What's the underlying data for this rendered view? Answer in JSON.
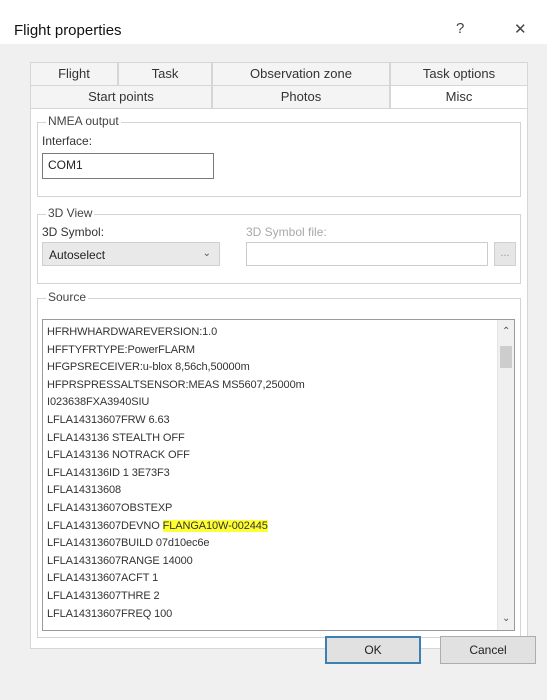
{
  "window": {
    "title": "Flight properties",
    "help_label": "?",
    "close_label": "✕"
  },
  "tabs": {
    "row1": [
      "Flight",
      "Task",
      "Observation zone",
      "Task options"
    ],
    "row2": [
      "Start points",
      "Photos",
      "Misc"
    ],
    "active": "Misc"
  },
  "nmea": {
    "group_label": "NMEA output",
    "interface_label": "Interface:",
    "interface_value": "COM1"
  },
  "view3d": {
    "group_label": "3D View",
    "symbol_label": "3D Symbol:",
    "symbol_value": "Autoselect",
    "symbol_file_label": "3D Symbol file:",
    "symbol_file_value": "",
    "browse_label": "..."
  },
  "source": {
    "group_label": "Source",
    "lines": [
      "HFRHWHARDWAREVERSION:1.0",
      "HFFTYFRTYPE:PowerFLARM",
      "HFGPSRECEIVER:u-blox 8,56ch,50000m",
      "HFPRSPRESSALTSENSOR:MEAS MS5607,25000m",
      "I023638FXA3940SIU",
      "LFLA14313607FRW 6.63",
      "LFLA143136 STEALTH OFF",
      "LFLA143136 NOTRACK OFF",
      "LFLA143136ID 1 3E73F3",
      "LFLA14313608",
      "LFLA14313607OBSTEXP",
      "LFLA14313607DEVNO ",
      "LFLA14313607BUILD 07d10ec6e",
      "LFLA14313607RANGE 14000",
      "LFLA14313607ACFT 1",
      "LFLA14313607THRE 2",
      "LFLA14313607FREQ 100"
    ],
    "highlight_line_index": 11,
    "highlight_text": "FLANGA10W-002445"
  },
  "buttons": {
    "ok": "OK",
    "cancel": "Cancel"
  }
}
